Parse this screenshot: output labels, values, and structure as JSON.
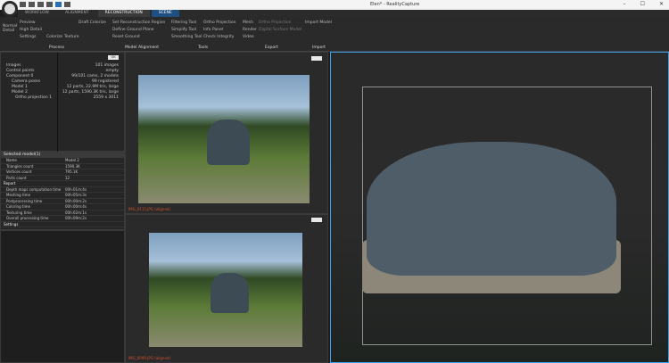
{
  "window": {
    "title": "Elen* - RealityCapture",
    "minimize": "–",
    "maximize": "☐",
    "close": "✕"
  },
  "tabs": [
    "WORKFLOW",
    "ALIGNMENT",
    "RECONSTRUCTION",
    "SCENE"
  ],
  "ribbon": {
    "process": {
      "items": [
        "Normal Detail",
        "Preview",
        "High Detail",
        "Settings",
        "Colorize",
        "Texture",
        "Draft Colorize"
      ],
      "label": "Process"
    },
    "model_alignment": {
      "items": [
        "Set Reconstruction Region",
        "Define Ground Plane",
        "Reset Ground"
      ],
      "label": "Model Alignment"
    },
    "tools": {
      "items": [
        "Filtering Tool",
        "Simplify Tool",
        "Smoothing Tool",
        "Ortho Projection",
        "Info Panel",
        "Check Integrity"
      ],
      "label": "Tools"
    },
    "export": {
      "items": [
        "Mesh",
        "Render",
        "Video",
        "Ortho Projection",
        "Digital Surface Model"
      ],
      "label": "Export"
    },
    "import": {
      "items": [
        "Import Model"
      ],
      "label": "Import"
    }
  },
  "tree": {
    "rows": [
      {
        "label": "Images",
        "value": "101 images"
      },
      {
        "label": "Control points",
        "value": "empty"
      },
      {
        "label": "Component 0",
        "value": "99/101 cams, 2 models"
      },
      {
        "label": "Camera poses",
        "value": "99 registered"
      },
      {
        "label": "Model 1",
        "value": "12 parts, 22.9M tris, large"
      },
      {
        "label": "Model 2",
        "value": "12 parts, 1590.3K tris, large"
      },
      {
        "label": "Ortho projection 1",
        "value": "2559 x 3011"
      }
    ],
    "ok": "OK"
  },
  "selected": {
    "title": "Selected model(1)",
    "rows": [
      [
        "Name",
        "Model 2"
      ],
      [
        "Triangles count",
        "1590.3K"
      ],
      [
        "Vertices count",
        "795.1K"
      ],
      [
        "Parts count",
        "12"
      ]
    ],
    "report_label": "Report",
    "report": [
      [
        "Depth maps computation time",
        "00h:01m:4s"
      ],
      [
        "Meshing time",
        "00h:05m:3s"
      ],
      [
        "Postprocessing time",
        "00h:00m:2s"
      ],
      [
        "Coloring time",
        "00h:00m:4s"
      ],
      [
        "Texturing time",
        "00h:02m:1s"
      ],
      [
        "Overall processing time",
        "00h:09m:2s"
      ]
    ],
    "settings_label": "Settings"
  },
  "image_panels": [
    {
      "caption": "IMG_0115.JPG (aligned)"
    },
    {
      "caption": "IMG_0099.JPG (aligned)"
    }
  ]
}
